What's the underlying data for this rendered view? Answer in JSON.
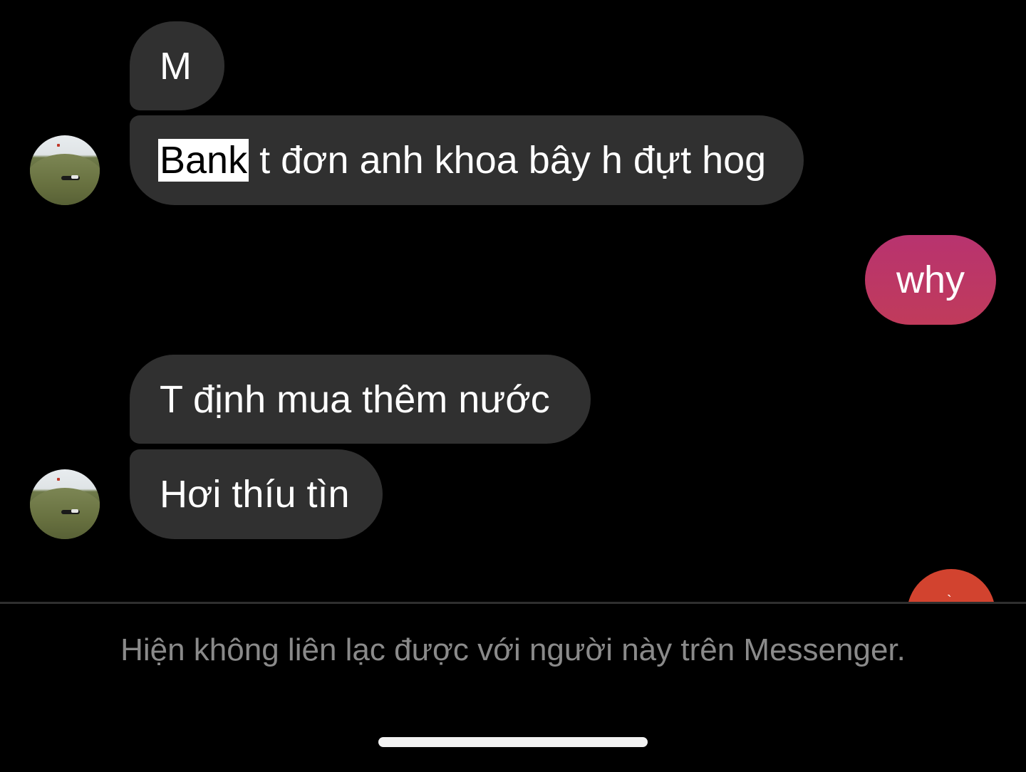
{
  "messages": [
    {
      "sender": "them",
      "text": "M"
    },
    {
      "sender": "them",
      "highlighted": "Bank",
      "text": " t đơn anh khoa bây h đựt hog"
    },
    {
      "sender": "me",
      "text": "why"
    },
    {
      "sender": "them",
      "text": "T định mua thêm nước"
    },
    {
      "sender": "them",
      "text": "Hơi thíu tìn"
    }
  ],
  "partial_avatar": {
    "glyph": "`",
    "color": "#d2432f"
  },
  "footer": {
    "notice": "Hiện không liên lạc được với người này trên Messenger."
  },
  "colors": {
    "incoming_bubble": "#303030",
    "outgoing_bubble": "#b8336f",
    "background": "#000000",
    "notice_text": "#8a8a8a"
  },
  "icons": {
    "contact_avatar": "avatar-photo-icon"
  }
}
